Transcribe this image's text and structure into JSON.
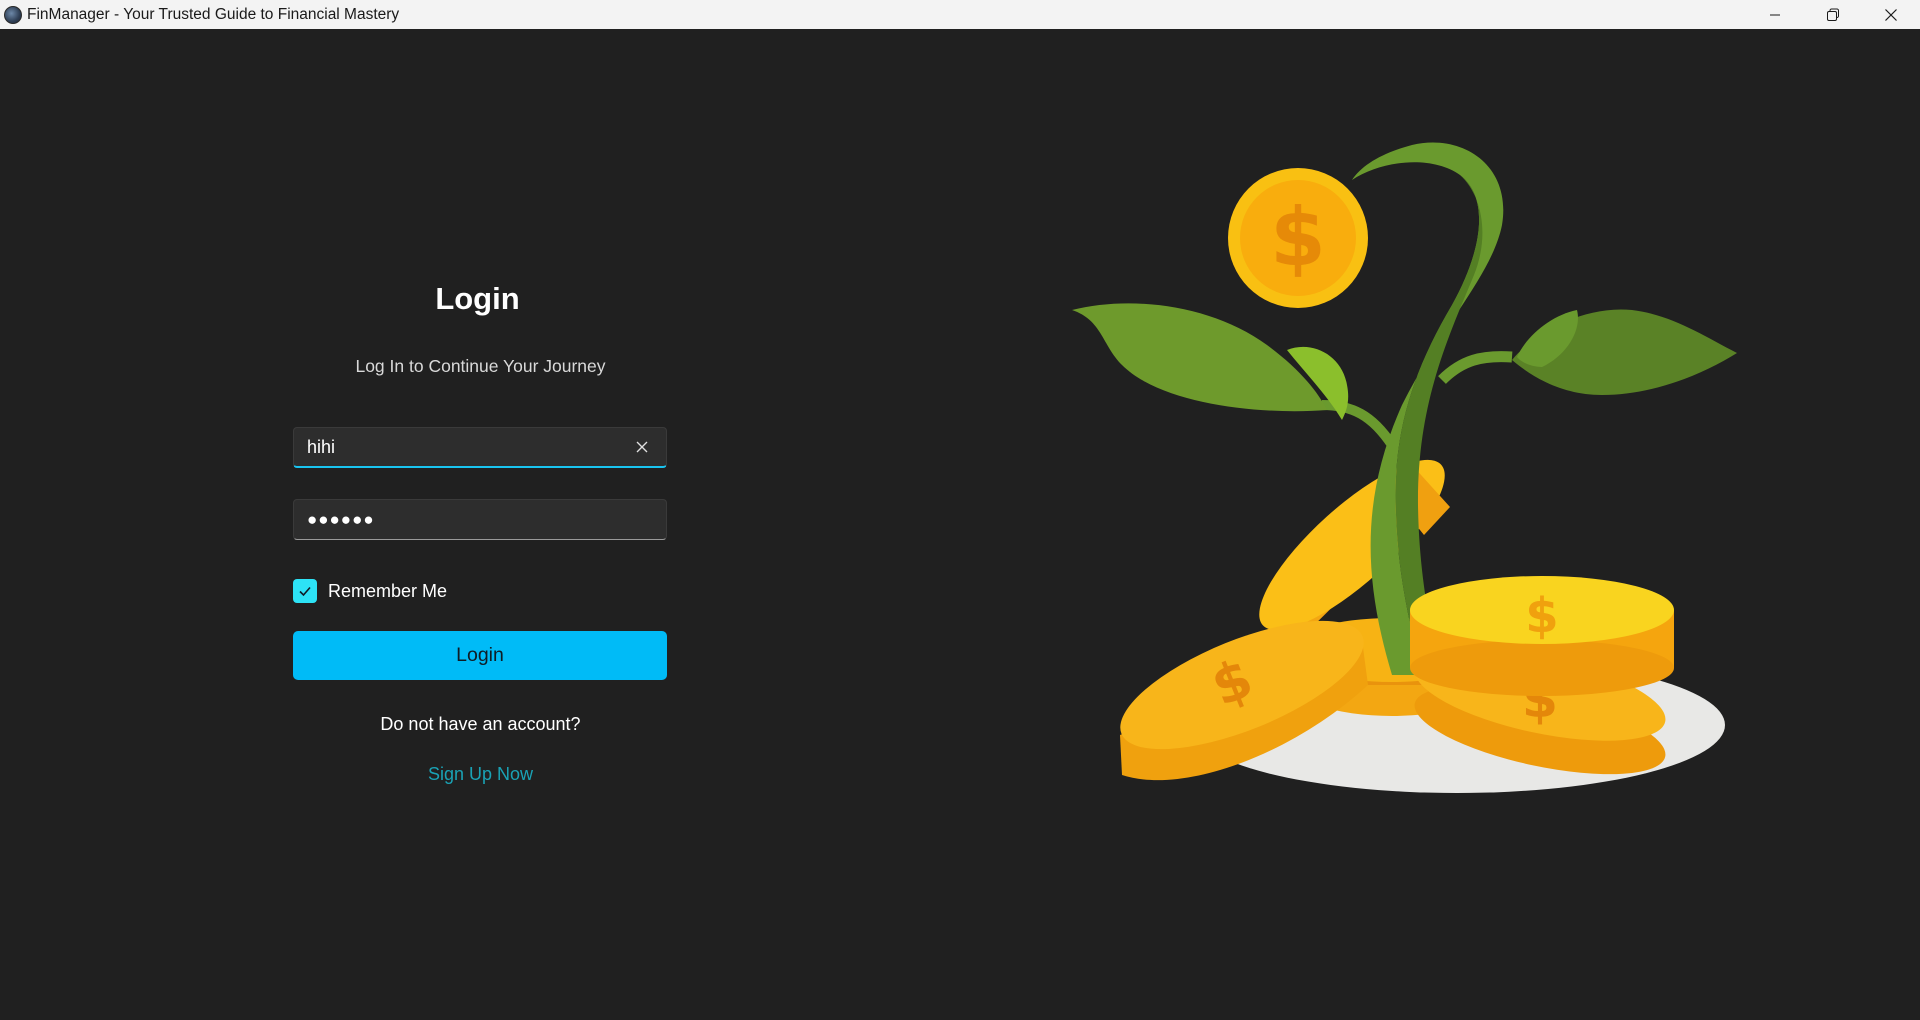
{
  "window": {
    "title": "FinManager - Your Trusted Guide to Financial Mastery",
    "icon": "app-logo-icon",
    "controls": [
      "minimize-icon",
      "restore-icon",
      "close-icon"
    ]
  },
  "login": {
    "title": "Login",
    "subtitle": "Log In to Continue Your Journey",
    "username": {
      "value": "hihi",
      "clear_icon": "clear-icon"
    },
    "password": {
      "value": "●●●●●●"
    },
    "remember_me": {
      "label": "Remember Me",
      "checked": true
    },
    "login_button": "Login",
    "no_account_text": "Do not have an account?",
    "signup_link": "Sign Up Now"
  },
  "colors": {
    "background": "#202020",
    "accent": "#00bbf7",
    "checkbox": "#2de3f6",
    "link": "#1aa2b5",
    "focus_underline": "#19c4f0"
  },
  "illustration": {
    "name": "money-plant-with-coins-illustration"
  }
}
